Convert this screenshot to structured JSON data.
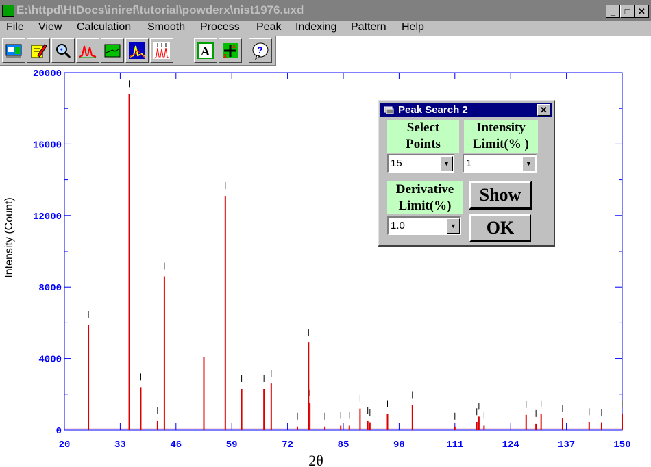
{
  "window": {
    "title": "E:\\httpd\\HtDocs\\iniref\\tutorial\\powderx\\nist1976.uxd"
  },
  "menu": [
    "File",
    "View",
    "Calculation",
    "Smooth",
    "Process",
    "Peak",
    "Indexing",
    "Pattern",
    "Help"
  ],
  "toolbar": {
    "icons": [
      "open-data-icon",
      "edit-icon",
      "zoom-icon",
      "smooth-peaks-icon",
      "background-icon",
      "peak-fit-icon",
      "peak-search-icon",
      "text-label-icon",
      "marker-icon",
      "help-icon"
    ]
  },
  "colors": {
    "trace": "#dd0000",
    "axis": "#0000ff",
    "dialog_title": "#000080",
    "label_bg": "#c0ffc0"
  },
  "chart_data": {
    "type": "line",
    "xlabel": "2θ",
    "ylabel": "Intensity (Count)",
    "xlim": [
      20,
      150
    ],
    "ylim": [
      0,
      20000
    ],
    "xticks": [
      "20",
      "33",
      "46",
      "59",
      "72",
      "85",
      "98",
      "111",
      "124",
      "137",
      "150"
    ],
    "yticks": [
      "0",
      "4000",
      "8000",
      "12000",
      "16000",
      "20000"
    ],
    "peaks": [
      {
        "x": 25.6,
        "y": 5900
      },
      {
        "x": 35.1,
        "y": 18800
      },
      {
        "x": 37.8,
        "y": 2400
      },
      {
        "x": 41.7,
        "y": 500
      },
      {
        "x": 43.3,
        "y": 8600
      },
      {
        "x": 52.5,
        "y": 4100
      },
      {
        "x": 57.5,
        "y": 13100
      },
      {
        "x": 61.3,
        "y": 2300
      },
      {
        "x": 66.5,
        "y": 2300
      },
      {
        "x": 68.2,
        "y": 2600
      },
      {
        "x": 74.3,
        "y": 200
      },
      {
        "x": 76.9,
        "y": 4900
      },
      {
        "x": 77.2,
        "y": 1500
      },
      {
        "x": 80.7,
        "y": 200
      },
      {
        "x": 84.4,
        "y": 250
      },
      {
        "x": 86.4,
        "y": 250
      },
      {
        "x": 88.9,
        "y": 1200
      },
      {
        "x": 90.7,
        "y": 500
      },
      {
        "x": 91.2,
        "y": 400
      },
      {
        "x": 95.3,
        "y": 900
      },
      {
        "x": 101.1,
        "y": 1400
      },
      {
        "x": 111.0,
        "y": 200
      },
      {
        "x": 116.1,
        "y": 450
      },
      {
        "x": 116.6,
        "y": 750
      },
      {
        "x": 117.8,
        "y": 250
      },
      {
        "x": 127.6,
        "y": 850
      },
      {
        "x": 129.9,
        "y": 350
      },
      {
        "x": 131.1,
        "y": 900
      },
      {
        "x": 136.1,
        "y": 650
      },
      {
        "x": 142.3,
        "y": 450
      },
      {
        "x": 145.2,
        "y": 400
      },
      {
        "x": 150.0,
        "y": 900
      }
    ]
  },
  "dialog": {
    "title": "Peak Search 2",
    "close": "✕",
    "select_points_label": [
      "Select",
      "Points"
    ],
    "intensity_limit_label": [
      "Intensity",
      "Limit(% )"
    ],
    "derivative_limit_label": [
      "Derivative",
      "Limit(%)"
    ],
    "select_points_value": "15",
    "intensity_limit_value": "1",
    "derivative_limit_value": "1.0",
    "show_button": "Show",
    "ok_button": "OK"
  }
}
